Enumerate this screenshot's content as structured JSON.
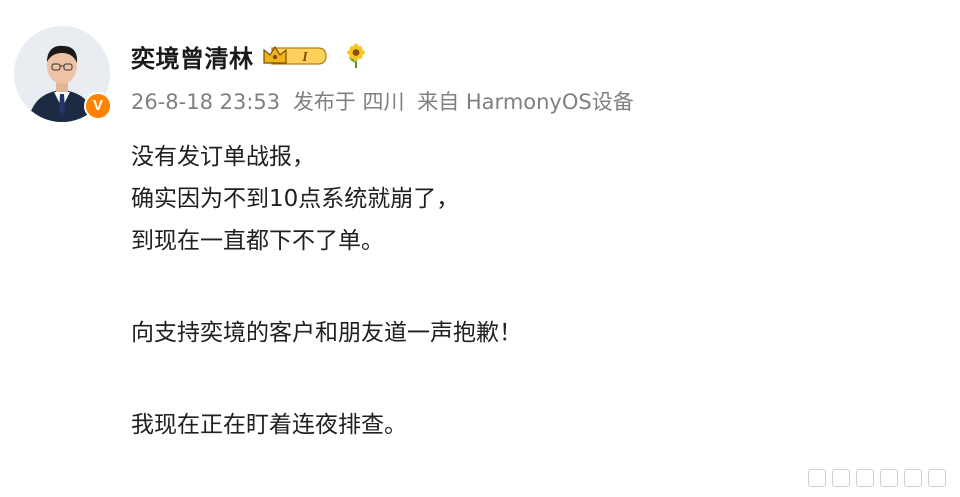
{
  "post": {
    "author": {
      "name": "奕境曾清林",
      "avatar": "avatar-photo-man-in-suit",
      "verified_icon": "verified-v-icon",
      "verified_glyph": "V",
      "vip_badge_label": "I",
      "decoration_icon": "sunflower-icon"
    },
    "meta": {
      "timestamp": "26-8-18 23:53",
      "location": "发布于 四川",
      "source": "来自 HarmonyOS设备"
    },
    "content": {
      "paragraph1": [
        "没有发订单战报，",
        "确实因为不到10点系统就崩了，",
        "到现在一直都下不了单。"
      ],
      "paragraph2": [
        "向支持奕境的客户和朋友道一声抱歉！"
      ],
      "paragraph3": [
        "我现在正在盯着连夜排查。"
      ]
    }
  },
  "colors": {
    "meta_text": "#808080",
    "body_text": "#202020",
    "verified_orange": "#ff8200",
    "vip_gold": "#f5b820"
  }
}
